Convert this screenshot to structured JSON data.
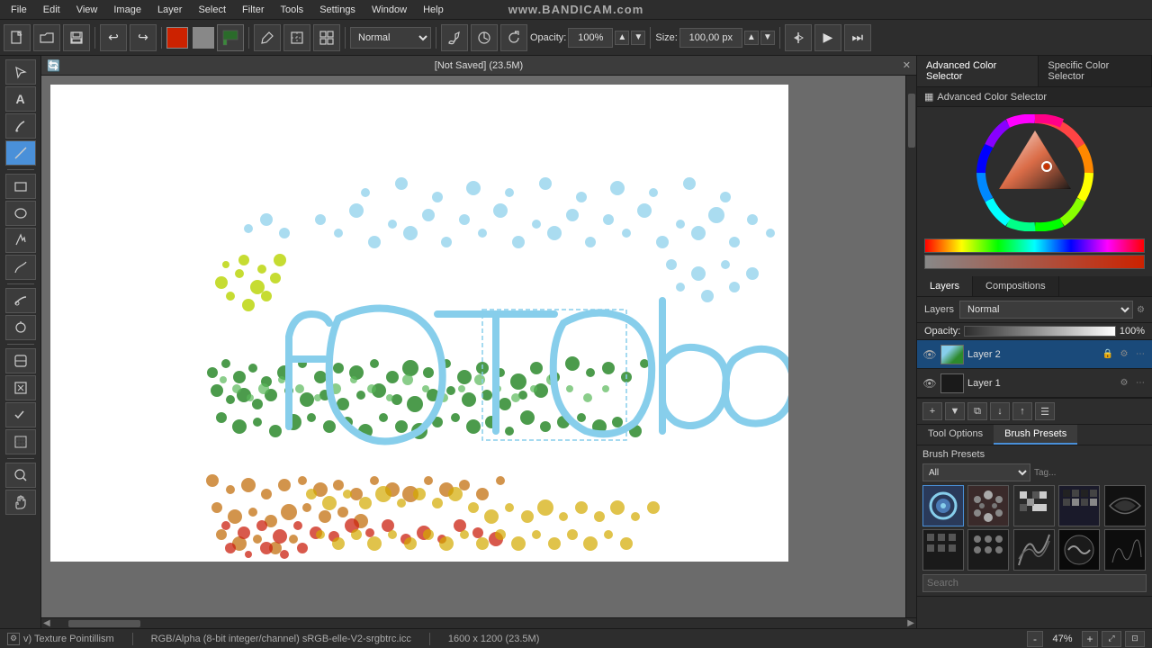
{
  "menu": {
    "items": [
      "File",
      "Edit",
      "View",
      "Image",
      "Layer",
      "Select",
      "Filter",
      "Tools",
      "Settings",
      "Window",
      "Help"
    ]
  },
  "bandicam": {
    "text": "www.BANDICAM.com"
  },
  "toolbar": {
    "blend_mode": "Normal",
    "opacity_label": "Opacity:",
    "opacity_value": "100%",
    "size_label": "Size:",
    "size_value": "100,00 px",
    "new_btn": "📄",
    "open_btn": "📂",
    "save_btn": "💾",
    "undo_btn": "↩",
    "redo_btn": "↪"
  },
  "canvas": {
    "title": "[Not Saved]  (23.5M)",
    "close_btn": "✕"
  },
  "right_panel": {
    "tab_advanced": "Advanced Color Selector",
    "tab_specific": "Specific Color Selector",
    "section_title": "Advanced Color Selector",
    "layers_tab": "Layers",
    "compositions_tab": "Compositions",
    "layers_section": "Layers",
    "blend_mode": "Normal",
    "opacity_label": "Opacity:",
    "opacity_value": "100%",
    "layers": [
      {
        "name": "Layer 2",
        "visible": true,
        "active": true
      },
      {
        "name": "Layer 1",
        "visible": true,
        "active": false
      }
    ],
    "tool_options_tab": "Tool Options",
    "brush_presets_tab": "Brush Presets",
    "brush_presets_title": "Brush Presets",
    "brush_filter": "All",
    "tag_label": "Tag...",
    "search_placeholder": "Search"
  },
  "status": {
    "tool": "v) Texture Pointillism",
    "mode": "RGB/Alpha (8-bit integer/channel)  sRGB-elle-V2-srgbtrc.icc",
    "dimensions": "1600 x 1200 (23.5M)",
    "zoom": "47%"
  }
}
